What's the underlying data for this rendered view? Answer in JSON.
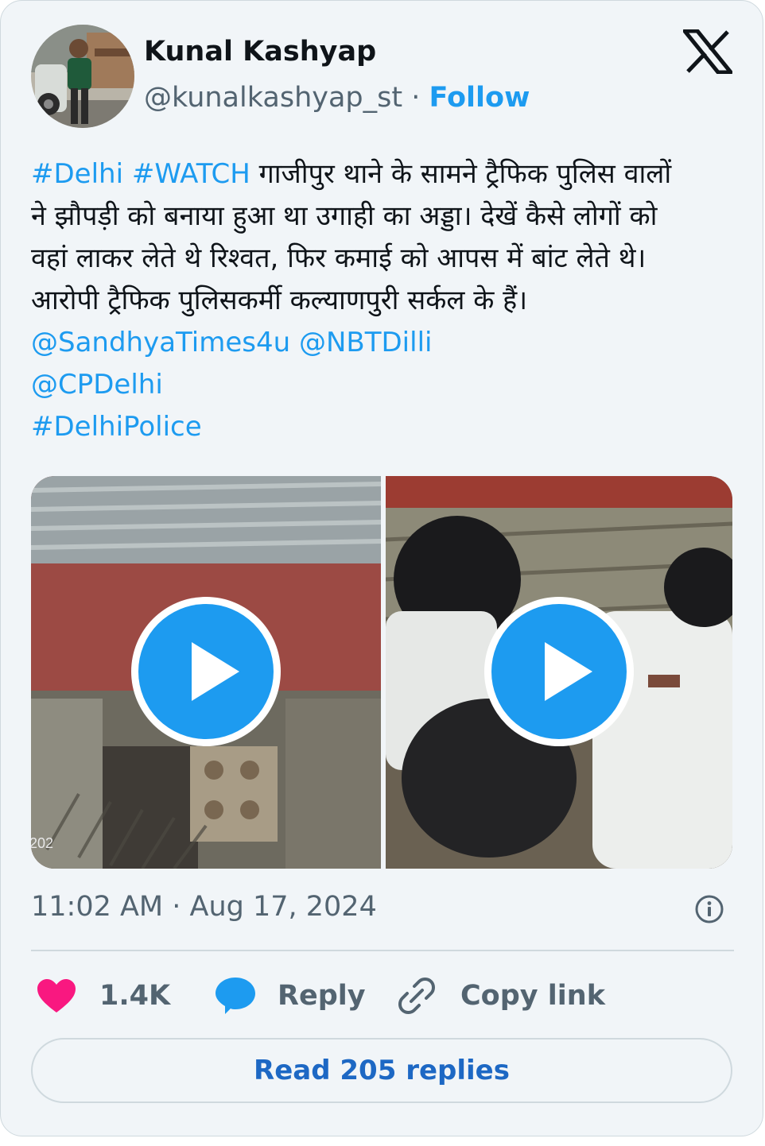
{
  "author": {
    "name": "Kunal Kashyap",
    "handle": "@kunalkashyap_st",
    "separator": "·",
    "follow_label": "Follow"
  },
  "tweet": {
    "hashtag_1": "#Delhi",
    "hashtag_2": "#WATCH",
    "line_1": "गाजीपुर थाने के सामने ट्रैफिक पुलिस वालों",
    "line_2": "ने झौपड़ी को बनाया हुआ था उगाही का अड्डा। देखें कैसे लोगों को",
    "line_3": "वहां लाकर लेते थे रिश्वत, फिर कमाई को आपस में बांट लेते थे।",
    "line_4": "आरोपी ट्रैफिक पुलिसकर्मी कल्याणपुरी सर्कल के हैं।",
    "mention_1": "@SandhyaTimes4u",
    "mention_2": "@NBTDilli",
    "mention_3": "@CPDelhi",
    "hashtag_3": "#DelhiPolice"
  },
  "media": {
    "left_video_overlay": "202",
    "play_icon": "play-icon"
  },
  "meta": {
    "timestamp": "11:02 AM · Aug 17, 2024",
    "info_icon": "info-icon"
  },
  "actions": {
    "like_count": "1.4K",
    "reply_label": "Reply",
    "copy_link_label": "Copy link"
  },
  "read_replies_label": "Read 205 replies",
  "colors": {
    "accent": "#1d9bf0",
    "like": "#f91880",
    "muted": "#536471",
    "card_bg": "#f1f5f8"
  }
}
